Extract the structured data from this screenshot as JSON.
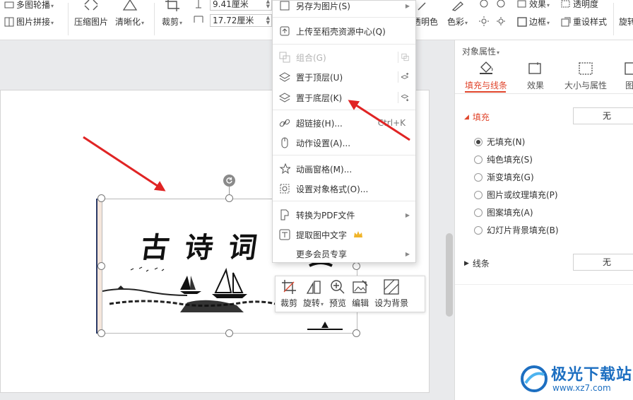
{
  "ribbon": {
    "multi_carousel": "多图轮播",
    "picture_collage": "图片拼接",
    "compress_picture": "压缩图片",
    "sharpen": "清晰化",
    "crop": "裁剪",
    "height_value": "9.41厘米",
    "width_value": "17.72厘米",
    "transparent_color": "透明色",
    "color": "色彩",
    "effects": "效果",
    "transparency": "透明度",
    "border": "边框",
    "reset_style": "重设样式",
    "rotate": "旋转"
  },
  "context_menu": {
    "save_as_picture": "另存为图片(S)",
    "upload_docer": "上传至稻壳资源中心(Q)",
    "group": "组合(G)",
    "bring_to_front": "置于顶层(U)",
    "send_to_back": "置于底层(K)",
    "hyperlink": "超链接(H)...",
    "hyperlink_shortcut": "Ctrl+K",
    "action_settings": "动作设置(A)...",
    "animation_pane": "动画窗格(M)...",
    "format_object": "设置对象格式(O)...",
    "convert_pdf": "转换为PDF文件",
    "extract_text": "提取图中文字",
    "more_member": "更多会员专享"
  },
  "quick_toolbar": {
    "crop": "裁剪",
    "rotate": "旋转",
    "preview": "预览",
    "edit": "编辑",
    "set_background": "设为背景"
  },
  "picture": {
    "calligraphy": "古诗词"
  },
  "panel": {
    "title": "对象属性",
    "tabs": [
      "填充与线条",
      "效果",
      "大小与属性",
      "图"
    ],
    "fill_section": "填充",
    "fill_value": "无",
    "fill_options": [
      "无填充(N)",
      "纯色填充(S)",
      "渐变填充(G)",
      "图片或纹理填充(P)",
      "图案填充(A)",
      "幻灯片背景填充(B)"
    ],
    "line_section": "线条",
    "line_value": "无"
  },
  "watermark": {
    "name": "极光下载站",
    "url": "www.xz7.com"
  },
  "colors": {
    "accent_red": "#e0452c",
    "arrow_red": "#e02424",
    "watermark_blue": "#1d6fc1"
  }
}
